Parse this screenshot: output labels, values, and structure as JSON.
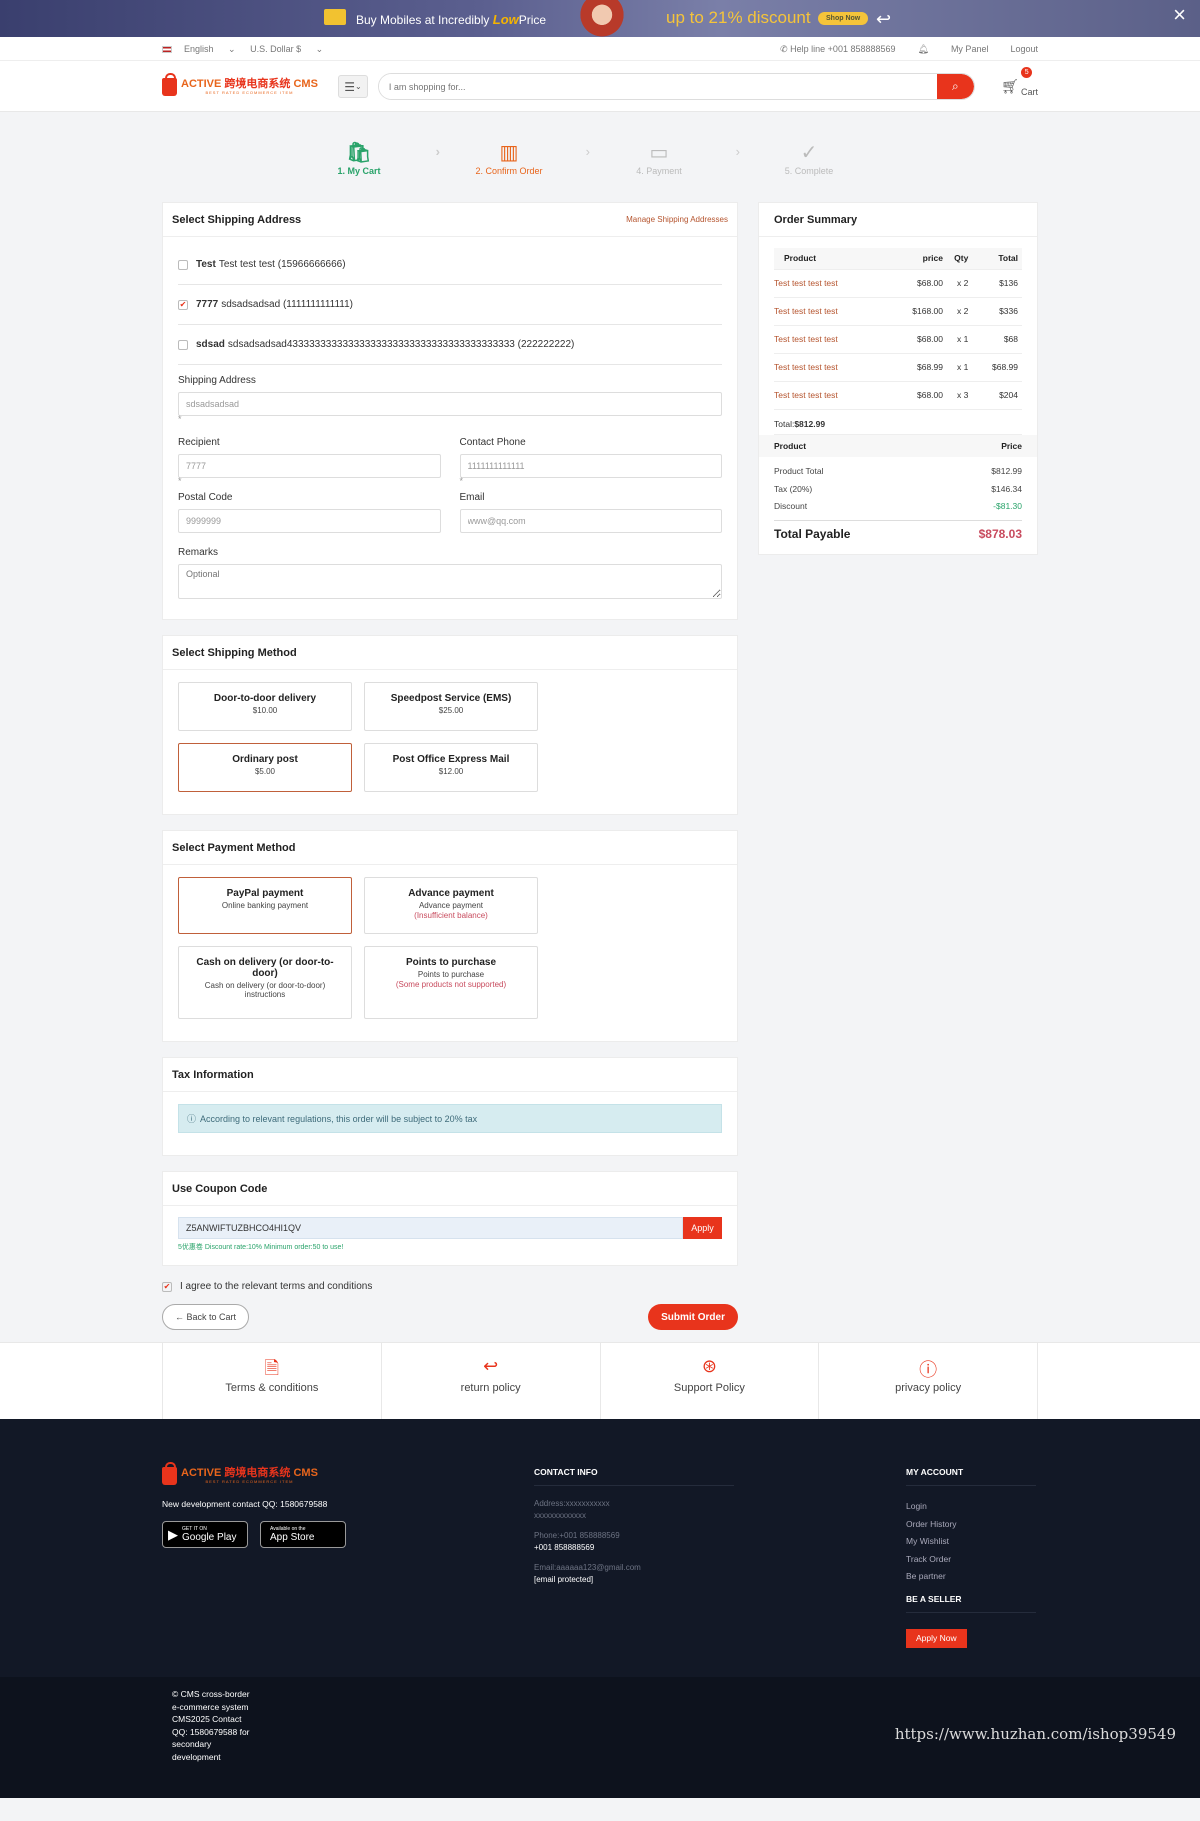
{
  "promo": {
    "text_prefix": "Buy Mobiles at Incredibly",
    "text_low": "Low",
    "text_suffix": "Price",
    "discount": "up to 21% discount",
    "shop_now": "Shop Now"
  },
  "topbar": {
    "language": "English",
    "currency": "U.S. Dollar $",
    "help_line": "Help line +001 858888569",
    "my_panel": "My Panel",
    "logout": "Logout"
  },
  "header": {
    "logo_en": "ACTIVE",
    "logo_cn": "跨境电商系统",
    "logo_cms": "CMS",
    "logo_sub": "BEST RATED ECOMMERCE ITEM",
    "search_placeholder": "I am shopping for...",
    "cart_count": "5",
    "cart_label": "Cart"
  },
  "steps": [
    {
      "label": "1. My Cart",
      "state": "done",
      "icon": "shopping-bag-icon"
    },
    {
      "label": "2. Confirm Order",
      "state": "active",
      "icon": "map-icon"
    },
    {
      "label": "4. Payment",
      "state": "todo",
      "icon": "credit-card-icon"
    },
    {
      "label": "5. Complete",
      "state": "todo",
      "icon": "check-circle-icon"
    }
  ],
  "shipping_address": {
    "title": "Select Shipping Address",
    "manage_link": "Manage Shipping Addresses",
    "addresses": [
      {
        "name": "Test",
        "detail": "Test test test (15966666666)",
        "checked": false
      },
      {
        "name": "7777",
        "detail": "sdsadsadsad (1111111111111)",
        "checked": true
      },
      {
        "name": "sdsad",
        "detail": "sdsadsadsad43333333333333333333333333333333333333333 (222222222)",
        "checked": false
      }
    ],
    "labels": {
      "address": "Shipping Address",
      "recipient": "Recipient",
      "phone": "Contact Phone",
      "postal": "Postal Code",
      "email": "Email",
      "remarks": "Remarks"
    },
    "values": {
      "address": "sdsadsadsad",
      "recipient": "7777",
      "phone": "1111111111111",
      "postal": "9999999",
      "email": "www@qq.com",
      "remarks_placeholder": "Optional"
    },
    "required_mark": "*"
  },
  "shipping_method": {
    "title": "Select Shipping Method",
    "options": [
      {
        "name": "Door-to-door delivery",
        "price": "$10.00",
        "selected": false
      },
      {
        "name": "Speedpost Service (EMS)",
        "price": "$25.00",
        "selected": false
      },
      {
        "name": "Ordinary post",
        "price": "$5.00",
        "selected": true
      },
      {
        "name": "Post Office Express Mail",
        "price": "$12.00",
        "selected": false
      }
    ]
  },
  "payment_method": {
    "title": "Select Payment Method",
    "options": [
      {
        "name": "PayPal payment",
        "desc": "Online banking payment",
        "warn": "",
        "selected": true
      },
      {
        "name": "Advance payment",
        "desc": "Advance payment",
        "warn": "(Insufficient balance)",
        "selected": false
      },
      {
        "name": "Cash on delivery (or door-to-door)",
        "desc": "Cash on delivery (or door-to-door) instructions",
        "warn": "",
        "selected": false
      },
      {
        "name": "Points to purchase",
        "desc": "Points to purchase",
        "warn": "(Some products not supported)",
        "selected": false
      }
    ]
  },
  "tax": {
    "title": "Tax Information",
    "notice": "According to relevant regulations, this order will be subject to 20% tax"
  },
  "coupon": {
    "title": "Use Coupon Code",
    "code": "Z5ANWIFTUZBHCO4HI1QV",
    "apply": "Apply",
    "note": "5优惠卷 Discount rate:10% Minimum order:50 to use!"
  },
  "agree_text": "I agree to the relevant terms and conditions",
  "buttons": {
    "back": "← Back to Cart",
    "submit": "Submit Order"
  },
  "summary": {
    "title": "Order Summary",
    "headers": {
      "product": "Product",
      "price": "price",
      "qty": "Qty",
      "total": "Total"
    },
    "rows": [
      {
        "product": "Test test test test",
        "price": "$68.00",
        "qty": "x 2",
        "total": "$136"
      },
      {
        "product": "Test test test test",
        "price": "$168.00",
        "qty": "x 2",
        "total": "$336"
      },
      {
        "product": "Test test test test",
        "price": "$68.00",
        "qty": "x 1",
        "total": "$68"
      },
      {
        "product": "Test test test test",
        "price": "$68.99",
        "qty": "x 1",
        "total": "$68.99"
      },
      {
        "product": "Test test test test",
        "price": "$68.00",
        "qty": "x 3",
        "total": "$204"
      }
    ],
    "total_label": "Total:",
    "total_value": "$812.99",
    "price_headers": {
      "product": "Product",
      "price": "Price"
    },
    "lines": [
      {
        "label": "Product Total",
        "value": "$812.99"
      },
      {
        "label": "Tax (20%)",
        "value": "$146.34"
      },
      {
        "label": "Discount",
        "value": "-$81.30"
      }
    ],
    "payable_label": "Total Payable",
    "payable_value": "$878.03"
  },
  "policies": [
    {
      "label": "Terms & conditions",
      "icon": "document-icon"
    },
    {
      "label": "return policy",
      "icon": "return-arrow-icon"
    },
    {
      "label": "Support Policy",
      "icon": "lifebuoy-icon"
    },
    {
      "label": "privacy policy",
      "icon": "alert-circle-icon"
    }
  ],
  "footer": {
    "contact_qq": "New development contact QQ: 1580679588",
    "google_small": "GET IT ON",
    "google_big": "Google Play",
    "apple_small": "Available on the",
    "apple_big": "App Store",
    "contact_title": "CONTACT INFO",
    "address_label": "Address:xxxxxxxxxxx",
    "address_value": "xxxxxxxxxxxxx",
    "phone_label": "Phone:+001 858888569",
    "phone_value": "+001 858888569",
    "email_label": "Email:aaaaaa123@gmail.com",
    "email_value": "[email protected]",
    "account_title": "MY ACCOUNT",
    "account_links": [
      "Login",
      "Order History",
      "My Wishlist",
      "Track Order",
      "Be partner"
    ],
    "seller_title": "BE A SELLER",
    "apply_now": "Apply Now",
    "copyright": "© CMS cross-border e-commerce system CMS2025 Contact QQ: 1580679588 for secondary development",
    "watermark": "https://www.huzhan.com/ishop39549"
  }
}
